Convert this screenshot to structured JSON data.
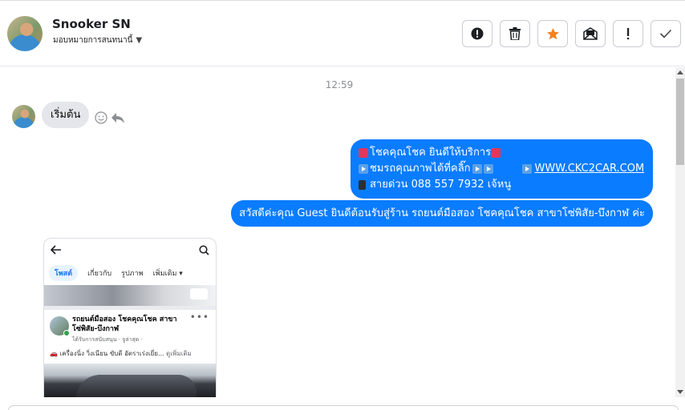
{
  "header": {
    "contact_name": "Snooker SN",
    "assign_label": "มอบหมายการสนทนานี้"
  },
  "actions": [
    {
      "name": "alert-icon"
    },
    {
      "name": "trash-icon"
    },
    {
      "name": "star-icon",
      "color": "#f5811f"
    },
    {
      "name": "mark-unread-icon"
    },
    {
      "name": "exclamation-icon"
    },
    {
      "name": "check-icon"
    }
  ],
  "chat": {
    "timestamp": "12:59",
    "incoming": {
      "text": "เริ่มต้น"
    },
    "outgoing_1": {
      "line1": "โชคคุณโชค ยินดีให้บริการ",
      "line2": "ชมรถคุณภาพได้ที่คลิ๊ก",
      "link": "WWW.CKC2CAR.COM",
      "line3": "สายด่วน 088 557 7932 เจ้หนู"
    },
    "outgoing_2": {
      "text": "สวัสดีค่ะคุณ Guest ยินดีต้อนรับสู่ร้าน รถยนต์มือสอง โชคคุณโชค สาขาโซ่พิสัย-บึงกาฬ ค่ะ"
    },
    "bubble_color": "#0a7cff"
  },
  "shared_post": {
    "tabs": [
      "โพสต์",
      "เกี่ยวกับ",
      "รูปภาพ",
      "เพิ่มเติม"
    ],
    "page_name": "รถยนต์มือสอง โชคคุณโชค สาขาโซ่พิสัย-บึงกาฬ",
    "meta": "ได้รับการสนับสนุน · จูล่าสุด ·",
    "text": "🚗 เครื่องนิ่ง วิ่งเนียน ขับดี อัตราเร่งเยี่ย...",
    "more": "ดูเพิ่มเติม"
  }
}
